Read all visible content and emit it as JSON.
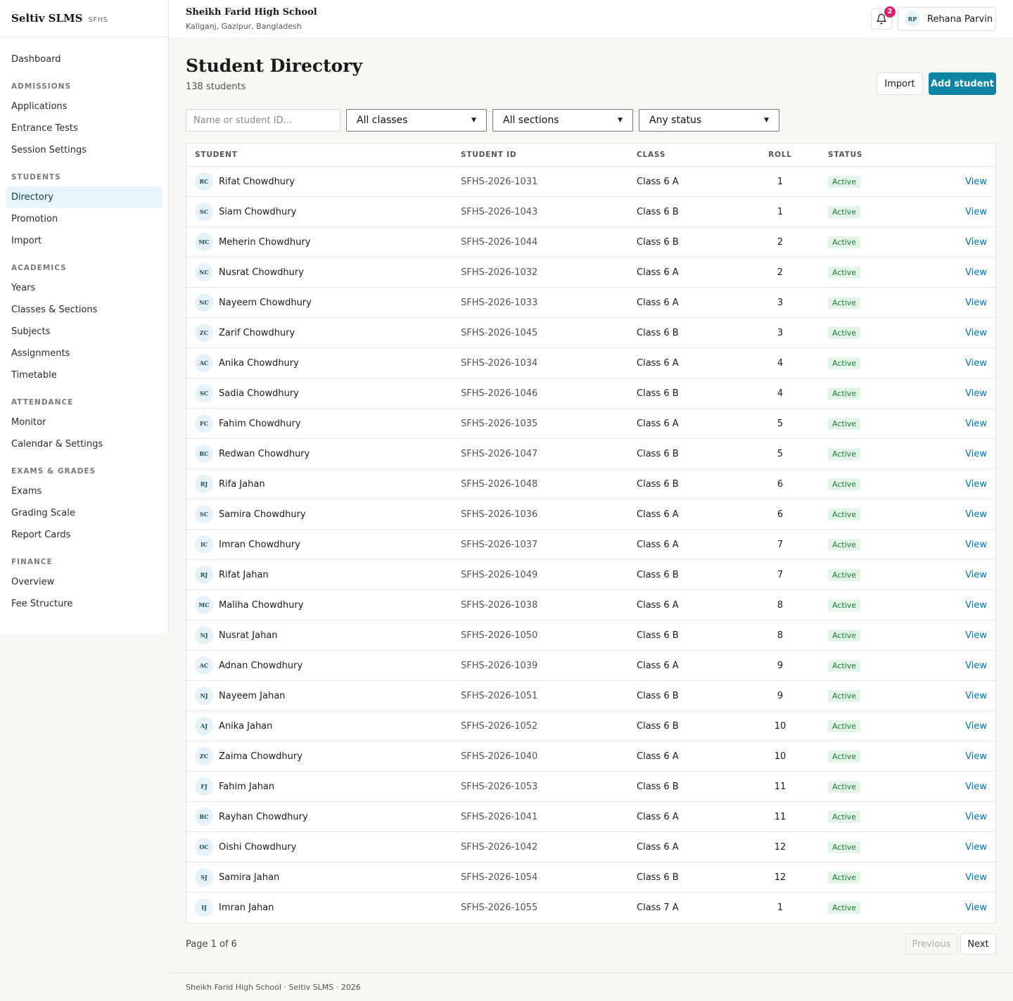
{
  "sidebar": {
    "brand": "Seltiv SLMS",
    "brand_code": "SFHS",
    "sections": [
      {
        "title": "",
        "items": [
          {
            "label": "Dashboard",
            "key": "dashboard"
          }
        ]
      },
      {
        "title": "ADMISSIONS",
        "items": [
          {
            "label": "Applications",
            "key": "applications"
          },
          {
            "label": "Entrance Tests",
            "key": "entrance-tests"
          },
          {
            "label": "Session Settings",
            "key": "session-settings"
          }
        ]
      },
      {
        "title": "STUDENTS",
        "items": [
          {
            "label": "Directory",
            "key": "directory",
            "active": true
          },
          {
            "label": "Promotion",
            "key": "promotion"
          },
          {
            "label": "Import",
            "key": "import"
          }
        ]
      },
      {
        "title": "ACADEMICS",
        "items": [
          {
            "label": "Years",
            "key": "years"
          },
          {
            "label": "Classes & Sections",
            "key": "classes-sections"
          },
          {
            "label": "Subjects",
            "key": "subjects"
          },
          {
            "label": "Assignments",
            "key": "assignments"
          },
          {
            "label": "Timetable",
            "key": "timetable"
          }
        ]
      },
      {
        "title": "ATTENDANCE",
        "items": [
          {
            "label": "Monitor",
            "key": "monitor"
          },
          {
            "label": "Calendar & Settings",
            "key": "calendar-settings"
          }
        ]
      },
      {
        "title": "EXAMS & GRADES",
        "items": [
          {
            "label": "Exams",
            "key": "exams"
          },
          {
            "label": "Grading Scale",
            "key": "grading-scale"
          },
          {
            "label": "Report Cards",
            "key": "report-cards"
          }
        ]
      },
      {
        "title": "FINANCE",
        "items": [
          {
            "label": "Overview",
            "key": "overview"
          },
          {
            "label": "Fee Structure",
            "key": "fee-structure"
          }
        ]
      }
    ]
  },
  "header": {
    "school_name": "Sheikh Farid High School",
    "school_location": "Kaliganj, Gazipur, Bangladesh",
    "notification_count": "2",
    "user_initials": "RP",
    "user_name": "Rehana Parvin"
  },
  "page": {
    "title": "Student Directory",
    "count": "138 students",
    "import_label": "Import",
    "add_label": "Add student"
  },
  "filters": {
    "search_placeholder": "Name or student ID…",
    "class_value": "All classes",
    "section_value": "All sections",
    "status_value": "Any status"
  },
  "table": {
    "headers": {
      "student": "STUDENT",
      "student_id": "STUDENT ID",
      "class": "CLASS",
      "roll": "ROLL",
      "status": "STATUS"
    },
    "view_label": "View",
    "rows": [
      {
        "initials": "RC",
        "name": "Rifat Chowdhury",
        "id": "SFHS-2026-1031",
        "class": "Class 6 A",
        "roll": "1",
        "status": "Active"
      },
      {
        "initials": "SC",
        "name": "Siam Chowdhury",
        "id": "SFHS-2026-1043",
        "class": "Class 6 B",
        "roll": "1",
        "status": "Active"
      },
      {
        "initials": "MC",
        "name": "Meherin Chowdhury",
        "id": "SFHS-2026-1044",
        "class": "Class 6 B",
        "roll": "2",
        "status": "Active"
      },
      {
        "initials": "NC",
        "name": "Nusrat Chowdhury",
        "id": "SFHS-2026-1032",
        "class": "Class 6 A",
        "roll": "2",
        "status": "Active"
      },
      {
        "initials": "NC",
        "name": "Nayeem Chowdhury",
        "id": "SFHS-2026-1033",
        "class": "Class 6 A",
        "roll": "3",
        "status": "Active"
      },
      {
        "initials": "ZC",
        "name": "Zarif Chowdhury",
        "id": "SFHS-2026-1045",
        "class": "Class 6 B",
        "roll": "3",
        "status": "Active"
      },
      {
        "initials": "AC",
        "name": "Anika Chowdhury",
        "id": "SFHS-2026-1034",
        "class": "Class 6 A",
        "roll": "4",
        "status": "Active"
      },
      {
        "initials": "SC",
        "name": "Sadia Chowdhury",
        "id": "SFHS-2026-1046",
        "class": "Class 6 B",
        "roll": "4",
        "status": "Active"
      },
      {
        "initials": "FC",
        "name": "Fahim Chowdhury",
        "id": "SFHS-2026-1035",
        "class": "Class 6 A",
        "roll": "5",
        "status": "Active"
      },
      {
        "initials": "RC",
        "name": "Redwan Chowdhury",
        "id": "SFHS-2026-1047",
        "class": "Class 6 B",
        "roll": "5",
        "status": "Active"
      },
      {
        "initials": "RJ",
        "name": "Rifa Jahan",
        "id": "SFHS-2026-1048",
        "class": "Class 6 B",
        "roll": "6",
        "status": "Active"
      },
      {
        "initials": "SC",
        "name": "Samira Chowdhury",
        "id": "SFHS-2026-1036",
        "class": "Class 6 A",
        "roll": "6",
        "status": "Active"
      },
      {
        "initials": "IC",
        "name": "Imran Chowdhury",
        "id": "SFHS-2026-1037",
        "class": "Class 6 A",
        "roll": "7",
        "status": "Active"
      },
      {
        "initials": "RJ",
        "name": "Rifat Jahan",
        "id": "SFHS-2026-1049",
        "class": "Class 6 B",
        "roll": "7",
        "status": "Active"
      },
      {
        "initials": "MC",
        "name": "Maliha Chowdhury",
        "id": "SFHS-2026-1038",
        "class": "Class 6 A",
        "roll": "8",
        "status": "Active"
      },
      {
        "initials": "NJ",
        "name": "Nusrat Jahan",
        "id": "SFHS-2026-1050",
        "class": "Class 6 B",
        "roll": "8",
        "status": "Active"
      },
      {
        "initials": "AC",
        "name": "Adnan Chowdhury",
        "id": "SFHS-2026-1039",
        "class": "Class 6 A",
        "roll": "9",
        "status": "Active"
      },
      {
        "initials": "NJ",
        "name": "Nayeem Jahan",
        "id": "SFHS-2026-1051",
        "class": "Class 6 B",
        "roll": "9",
        "status": "Active"
      },
      {
        "initials": "AJ",
        "name": "Anika Jahan",
        "id": "SFHS-2026-1052",
        "class": "Class 6 B",
        "roll": "10",
        "status": "Active"
      },
      {
        "initials": "ZC",
        "name": "Zaima Chowdhury",
        "id": "SFHS-2026-1040",
        "class": "Class 6 A",
        "roll": "10",
        "status": "Active"
      },
      {
        "initials": "FJ",
        "name": "Fahim Jahan",
        "id": "SFHS-2026-1053",
        "class": "Class 6 B",
        "roll": "11",
        "status": "Active"
      },
      {
        "initials": "RC",
        "name": "Rayhan Chowdhury",
        "id": "SFHS-2026-1041",
        "class": "Class 6 A",
        "roll": "11",
        "status": "Active"
      },
      {
        "initials": "OC",
        "name": "Oishi Chowdhury",
        "id": "SFHS-2026-1042",
        "class": "Class 6 A",
        "roll": "12",
        "status": "Active"
      },
      {
        "initials": "SJ",
        "name": "Samira Jahan",
        "id": "SFHS-2026-1054",
        "class": "Class 6 B",
        "roll": "12",
        "status": "Active"
      },
      {
        "initials": "IJ",
        "name": "Imran Jahan",
        "id": "SFHS-2026-1055",
        "class": "Class 7 A",
        "roll": "1",
        "status": "Active"
      }
    ]
  },
  "pagination": {
    "text": "Page 1 of 6",
    "previous_label": "Previous",
    "next_label": "Next"
  },
  "footer": {
    "text": "Sheikh Farid High School · Seltiv SLMS · 2026"
  },
  "colors": {
    "accent": "#0b84a5",
    "badge_bg": "#e3f4e8",
    "badge_text": "#1e7a3c",
    "notification": "#d6246e"
  }
}
